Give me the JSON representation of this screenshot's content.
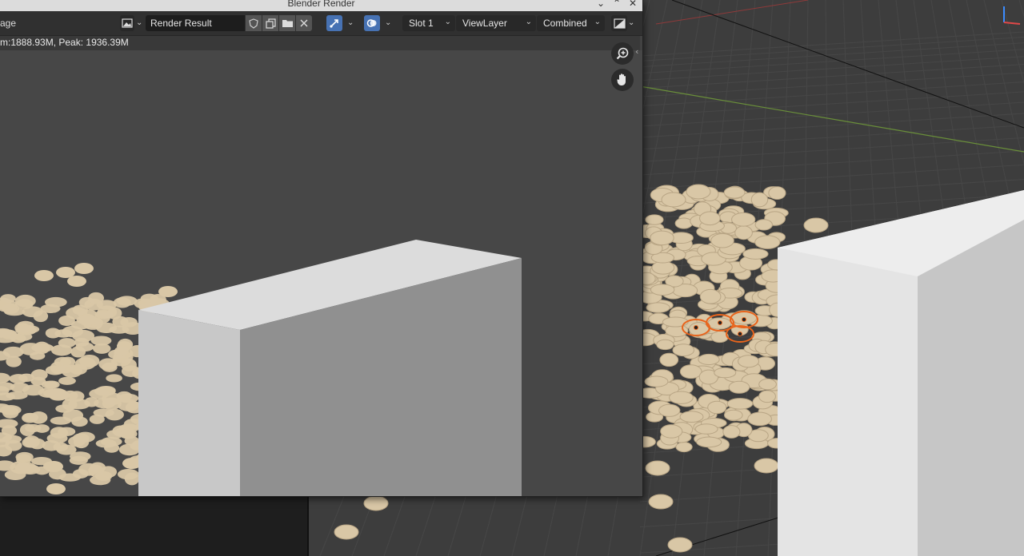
{
  "window": {
    "title": "Blender Render",
    "controls": [
      "minimize-icon",
      "maximize-icon",
      "close-icon"
    ]
  },
  "header": {
    "editor_label": "age",
    "image_name": "Render Result",
    "slot": "Slot 1",
    "view_layer": "ViewLayer",
    "pass": "Combined"
  },
  "stats": {
    "text": "m:1888.93M, Peak: 1936.39M"
  },
  "nav": {
    "zoom_icon": "zoom-icon",
    "pan_icon": "hand-icon"
  },
  "colors": {
    "header_bg": "#303030",
    "accent_blue": "#4772b3",
    "selection_orange": "#e8641c",
    "pebble": "#d9c7a6",
    "block": "#c9c9c9"
  }
}
